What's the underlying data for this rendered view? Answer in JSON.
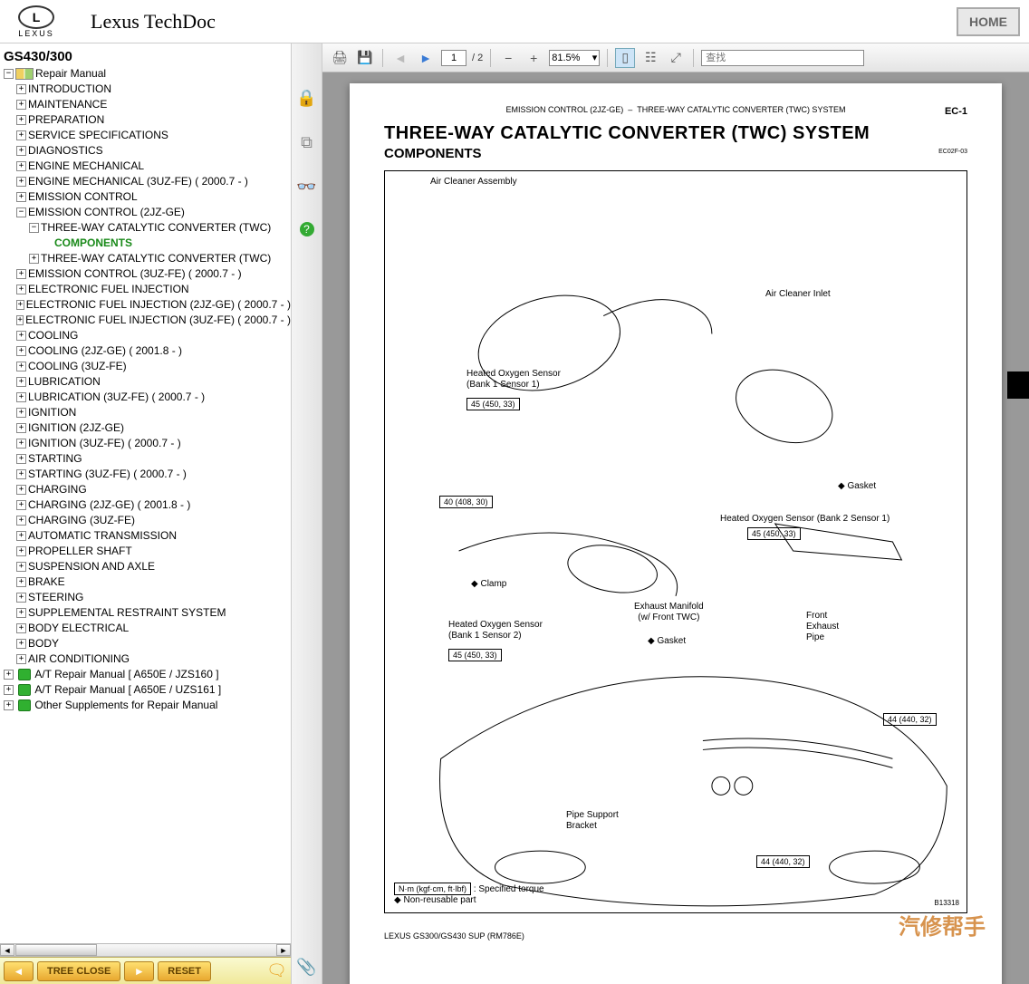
{
  "header": {
    "brand": "LEXUS",
    "app_title": "Lexus TechDoc",
    "home_btn": "HOME"
  },
  "sidebar": {
    "model": "GS430/300",
    "root": "Repair Manual",
    "items": [
      "INTRODUCTION",
      "MAINTENANCE",
      "PREPARATION",
      "SERVICE SPECIFICATIONS",
      "DIAGNOSTICS",
      "ENGINE MECHANICAL",
      "ENGINE MECHANICAL (3UZ-FE) ( 2000.7 - )",
      "EMISSION CONTROL"
    ],
    "expanded_section": "EMISSION CONTROL (2JZ-GE)",
    "sub1": "THREE-WAY CATALYTIC CONVERTER (TWC)",
    "selected": "COMPONENTS",
    "sub2": "THREE-WAY CATALYTIC CONVERTER (TWC)",
    "items2": [
      "EMISSION CONTROL (3UZ-FE) ( 2000.7 - )",
      "ELECTRONIC FUEL INJECTION",
      "ELECTRONIC FUEL INJECTION (2JZ-GE) ( 2000.7 - )",
      "ELECTRONIC FUEL INJECTION (3UZ-FE) ( 2000.7 - )",
      "COOLING",
      "COOLING (2JZ-GE) ( 2001.8 - )",
      "COOLING (3UZ-FE)",
      "LUBRICATION",
      "LUBRICATION (3UZ-FE) ( 2000.7 - )",
      "IGNITION",
      "IGNITION (2JZ-GE)",
      "IGNITION (3UZ-FE) ( 2000.7 - )",
      "STARTING",
      "STARTING (3UZ-FE) ( 2000.7 - )",
      "CHARGING",
      "CHARGING (2JZ-GE) ( 2001.8 - )",
      "CHARGING (3UZ-FE)",
      "AUTOMATIC TRANSMISSION",
      "PROPELLER SHAFT",
      "SUSPENSION AND AXLE",
      "BRAKE",
      "STEERING",
      "SUPPLEMENTAL RESTRAINT SYSTEM",
      "BODY ELECTRICAL",
      "BODY",
      "AIR CONDITIONING"
    ],
    "supplements": [
      "A/T Repair Manual [ A650E / JZS160 ]",
      "A/T Repair Manual [ A650E / UZS161 ]",
      "Other Supplements for Repair Manual"
    ],
    "footer": {
      "tree_close": "TREE CLOSE",
      "reset": "RESET"
    }
  },
  "toolbar": {
    "page_current": "1",
    "page_total": "/ 2",
    "zoom": "81.5%",
    "search_placeholder": "查找"
  },
  "document": {
    "breadcrumb_l": "EMISSION CONTROL (2JZ-GE)",
    "breadcrumb_sep": "–",
    "breadcrumb_r": "THREE-WAY CATALYTIC CONVERTER (TWC) SYSTEM",
    "ec_code": "EC-1",
    "title": "THREE-WAY CATALYTIC CONVERTER (TWC) SYSTEM",
    "subtitle": "COMPONENTS",
    "small_code": "EC02F-03",
    "labels": {
      "air_cleaner": "Air Cleaner Assembly",
      "air_inlet": "Air Cleaner Inlet",
      "hox_b1s1": "Heated Oxygen Sensor\n(Bank 1 Sensor 1)",
      "hox_b1s1_t": "45 (450, 33)",
      "t40": "40 (408, 30)",
      "clamp": "Clamp",
      "gasket1": "Gasket",
      "hox_b2s1": "Heated Oxygen Sensor (Bank 2 Sensor 1)",
      "hox_b2s1_t": "45 (450, 33)",
      "ex_manifold": "Exhaust Manifold\n(w/ Front TWC)",
      "hox_b1s2": "Heated Oxygen Sensor\n(Bank 1 Sensor 2)",
      "hox_b1s2_t": "45 (450, 33)",
      "gasket2": "Gasket",
      "front_pipe": "Front\nExhaust\nPipe",
      "t44a": "44 (440, 32)",
      "pipe_support": "Pipe Support\nBracket",
      "t44b": "44 (440, 32)",
      "legend_torque": "N·m (kgf·cm, ft·lbf)",
      "legend_torque_note": ": Specified torque",
      "legend_nonreuse": "◆ Non-reusable part",
      "bcode": "B13318"
    },
    "footer": "LEXUS GS300/GS430 SUP   (RM786E)",
    "watermark": "汽修帮手"
  }
}
